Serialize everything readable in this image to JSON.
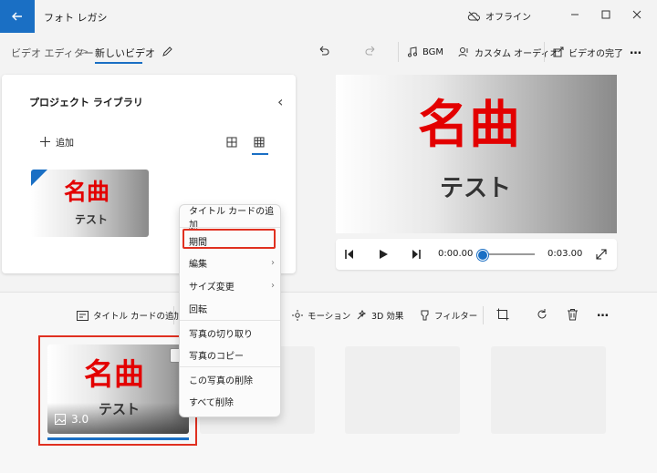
{
  "app": {
    "title": "フォト レガシ",
    "status": "オフライン"
  },
  "breadcrumb": {
    "parent": "ビデオ エディター",
    "separator": ">",
    "current": "新しいビデオ"
  },
  "toolbar": {
    "bgm": "BGM",
    "custom_audio": "カスタム オーディオ",
    "finish": "ビデオの完了",
    "more": "…"
  },
  "library": {
    "title": "プロジェクト ライブラリ",
    "add": "追加",
    "collapse": "‹"
  },
  "card": {
    "title": "名曲",
    "subtitle": "テスト",
    "duration": "3.0"
  },
  "player": {
    "current_time": "0:00.00",
    "total_time": "0:03.00",
    "progress": 0.0
  },
  "storyboard": {
    "add_title_card": "タイトル カードの追加",
    "motion": "モーション",
    "effects_3d": "3D 効果",
    "filter": "フィルター",
    "more": "…"
  },
  "context_menu": {
    "items": [
      {
        "label": "タイトル カードの追加",
        "submenu": false
      },
      {
        "label": "期間",
        "submenu": false,
        "highlighted": true
      },
      {
        "label": "編集",
        "submenu": true
      },
      {
        "label": "サイズ変更",
        "submenu": true
      },
      {
        "label": "回転",
        "submenu": false
      },
      {
        "label": "写真の切り取り",
        "submenu": false
      },
      {
        "label": "写真のコピー",
        "submenu": false
      },
      {
        "label": "この写真の削除",
        "submenu": false
      },
      {
        "label": "すべて削除",
        "submenu": false
      }
    ],
    "chevron": "›"
  },
  "colors": {
    "accent": "#1a6fc4",
    "highlight": "#e03020",
    "title_red": "#e30000"
  }
}
